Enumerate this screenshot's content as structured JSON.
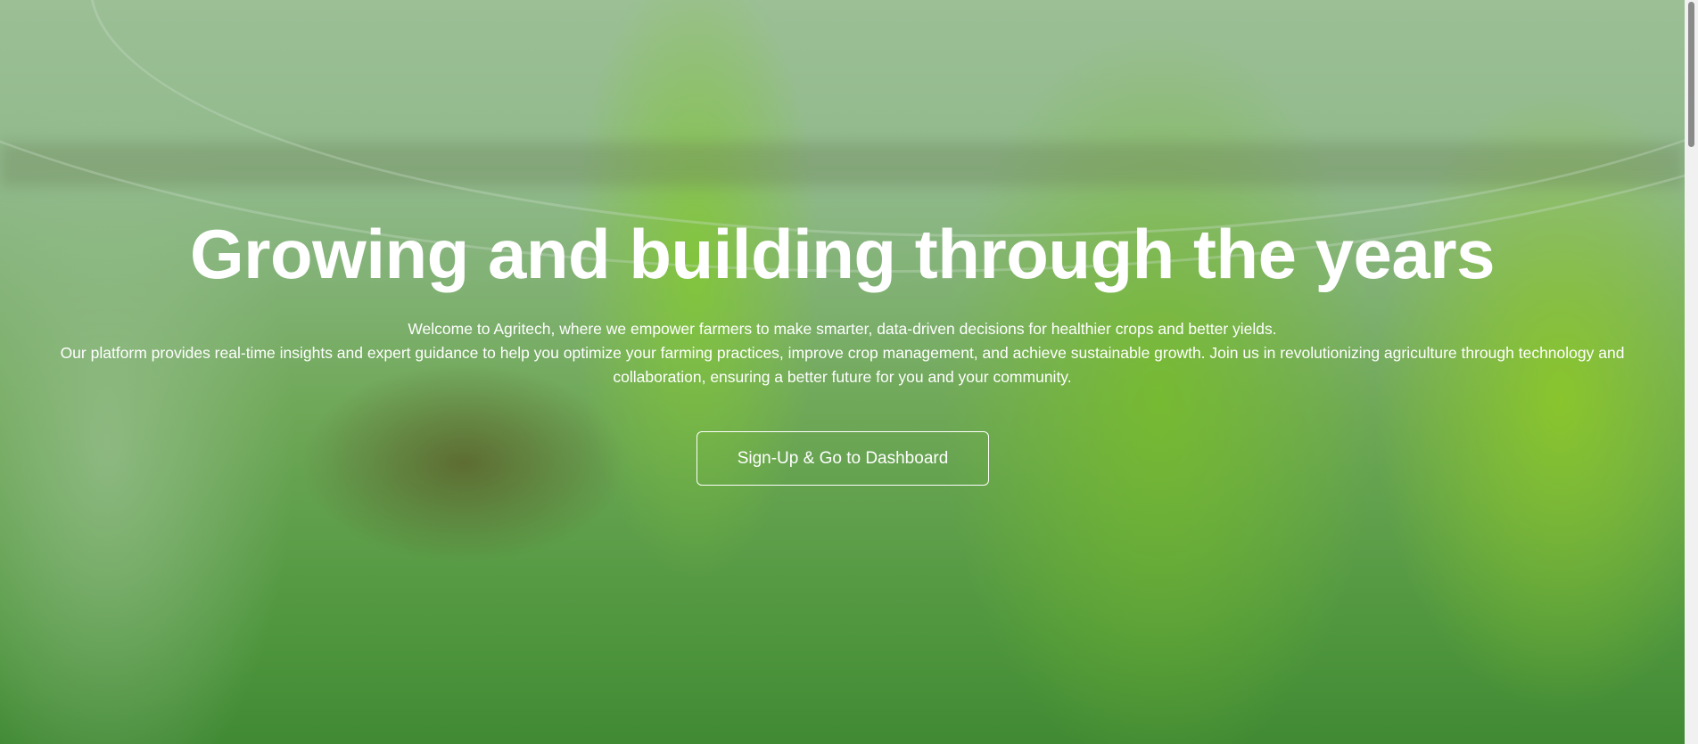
{
  "hero": {
    "title": "Growing and building through the years",
    "paragraph_lines": [
      "Welcome to Agritech, where we empower farmers to make smarter, data-driven decisions for healthier crops and better yields.",
      "Our platform provides real-time insights and expert guidance to help you optimize your farming practices, improve crop management, and achieve sustainable growth. Join us in revolutionizing agriculture through technology and",
      "collaboration, ensuring a better future for you and your community."
    ],
    "cta_label": "Sign-Up & Go to Dashboard"
  },
  "colors": {
    "overlay": "#6fa858",
    "text": "#ffffff"
  }
}
